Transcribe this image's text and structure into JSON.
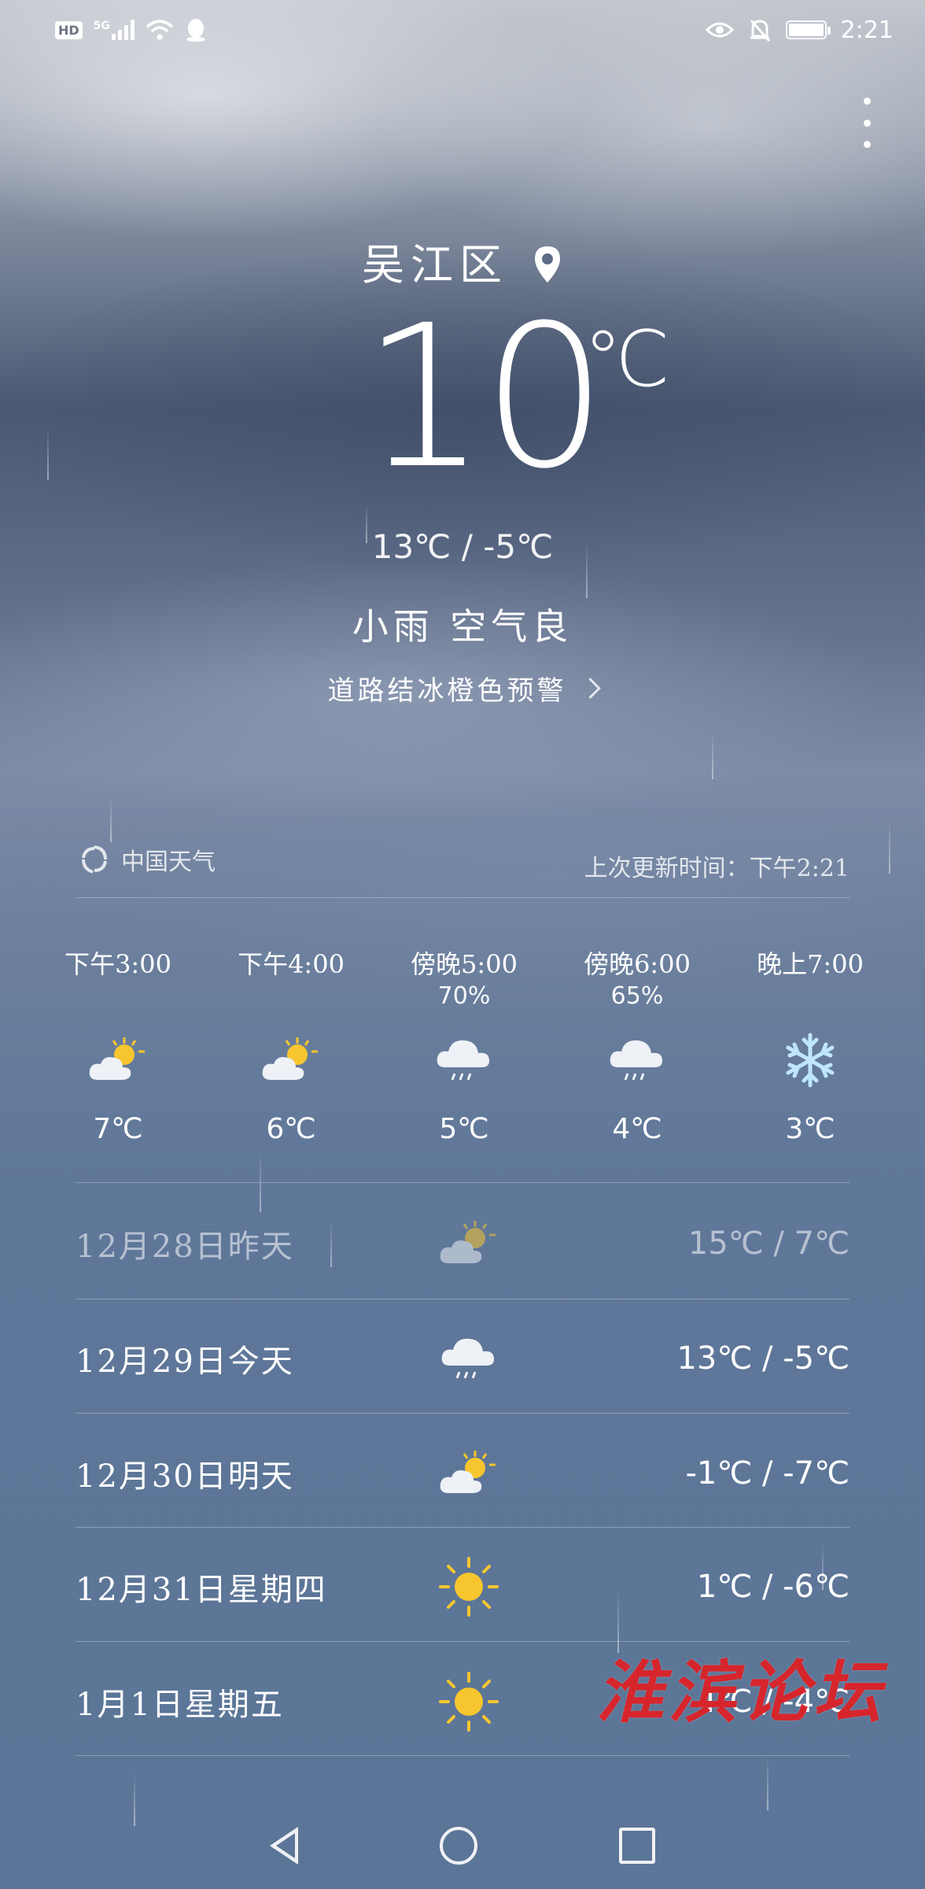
{
  "status_bar": {
    "hd": "HD",
    "network": "5G",
    "time": "2:21",
    "battery_level": 1.0
  },
  "location": {
    "name": "吴江区"
  },
  "current": {
    "temperature": "10",
    "unit": "℃",
    "range": "13℃ / -5℃",
    "condition": "小雨 空气良",
    "alert": "道路结冰橙色预警"
  },
  "source": {
    "provider": "中国天气",
    "updated": "上次更新时间：下午2:21"
  },
  "hourly": [
    {
      "time": "下午3:00",
      "precip": "",
      "icon": "partly-cloudy-icon",
      "temp": "7℃"
    },
    {
      "time": "下午4:00",
      "precip": "",
      "icon": "partly-cloudy-icon",
      "temp": "6℃"
    },
    {
      "time": "傍晚5:00",
      "precip": "70%",
      "icon": "rain-cloud-icon",
      "temp": "5℃"
    },
    {
      "time": "傍晚6:00",
      "precip": "65%",
      "icon": "rain-cloud-icon",
      "temp": "4℃"
    },
    {
      "time": "晚上7:00",
      "precip": "",
      "icon": "snowflake-icon",
      "temp": "3℃"
    }
  ],
  "daily": [
    {
      "date": "12月28日昨天",
      "icon": "partly-cloudy-icon",
      "range": "15℃ / 7℃"
    },
    {
      "date": "12月29日今天",
      "icon": "rain-cloud-icon",
      "range": "13℃ / -5℃"
    },
    {
      "date": "12月30日明天",
      "icon": "partly-cloudy-icon",
      "range": "-1℃ / -7℃"
    },
    {
      "date": "12月31日星期四",
      "icon": "sun-icon",
      "range": "1℃ / -6℃"
    },
    {
      "date": "1月1日星期五",
      "icon": "sun-icon",
      "range": "4℃ / -4℃"
    }
  ],
  "watermark": "淮滨论坛",
  "colors": {
    "sun": "#f7c62f",
    "cloud": "#eef1f6",
    "snow": "#bfe6ff",
    "watermark": "#d6262c"
  }
}
